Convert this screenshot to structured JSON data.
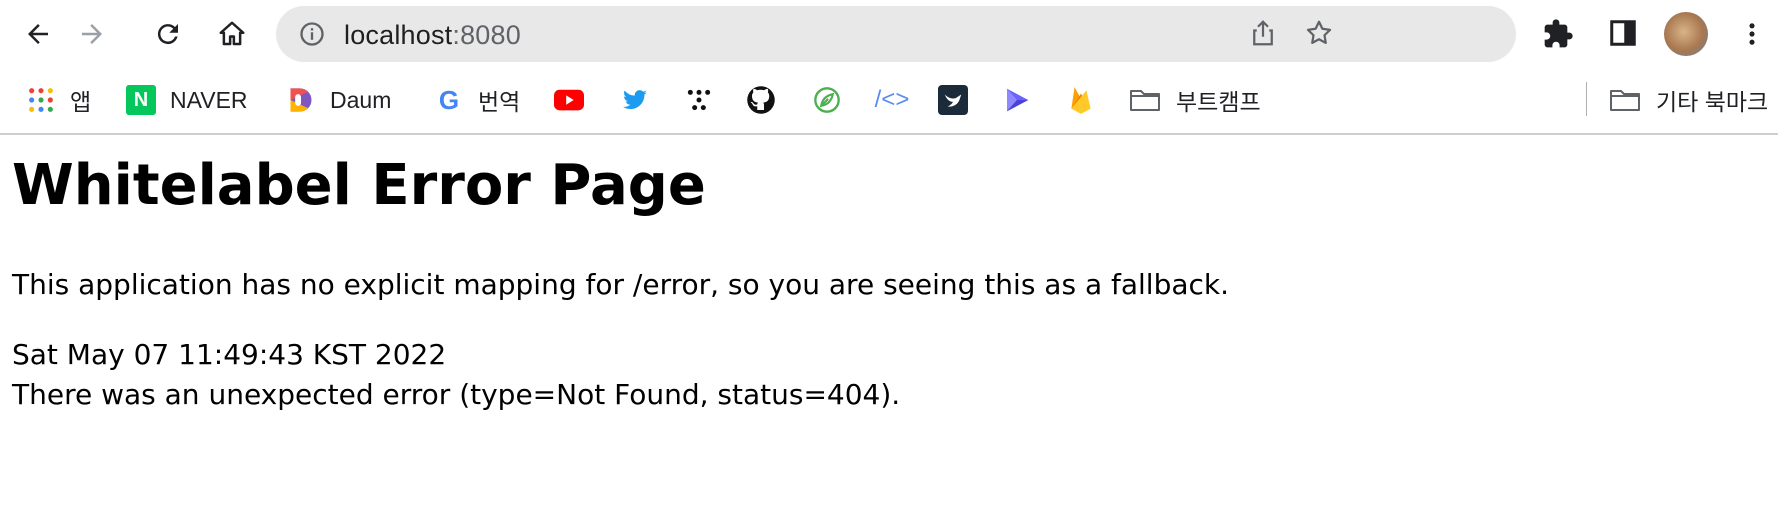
{
  "browser": {
    "address_bar": {
      "host": "localhost",
      "port": ":8080"
    },
    "toolbar_icons": [
      "back-arrow-icon",
      "forward-arrow-icon",
      "reload-icon",
      "home-icon",
      "site-info-icon",
      "share-icon",
      "star-icon",
      "extensions-icon",
      "side-panel-icon",
      "profile-avatar",
      "more-menu-icon"
    ],
    "bookmarks": [
      {
        "label": "앱",
        "icon": "apps-grid-icon"
      },
      {
        "label": "NAVER",
        "icon": "naver-icon"
      },
      {
        "label": "Daum",
        "icon": "daum-icon"
      },
      {
        "label": "번역",
        "icon": "google-icon"
      },
      {
        "label": "",
        "icon": "youtube-icon"
      },
      {
        "label": "",
        "icon": "twitter-icon"
      },
      {
        "label": "",
        "icon": "dots-icon"
      },
      {
        "label": "",
        "icon": "github-icon"
      },
      {
        "label": "",
        "icon": "leaf-icon"
      },
      {
        "label": "",
        "icon": "code-icon"
      },
      {
        "label": "",
        "icon": "bird-icon"
      },
      {
        "label": "",
        "icon": "play-cube-icon"
      },
      {
        "label": "",
        "icon": "firebase-icon"
      },
      {
        "label": "부트캠프",
        "icon": "folder-icon"
      }
    ],
    "other_bookmarks": {
      "label": "기타 북마크",
      "icon": "folder-icon"
    }
  },
  "page": {
    "title": "Whitelabel Error Page",
    "message": "This application has no explicit mapping for /error, so you are seeing this as a fallback.",
    "timestamp": "Sat May 07 11:49:43 KST 2022",
    "error_detail": "There was an unexpected error (type=Not Found, status=404)."
  },
  "colors": {
    "omnibox_bg": "#e8e8e8",
    "youtube_red": "#ff0000",
    "twitter_blue": "#1d9bf0",
    "naver_green": "#03c75a",
    "firebase_yellow": "#ffca28"
  }
}
